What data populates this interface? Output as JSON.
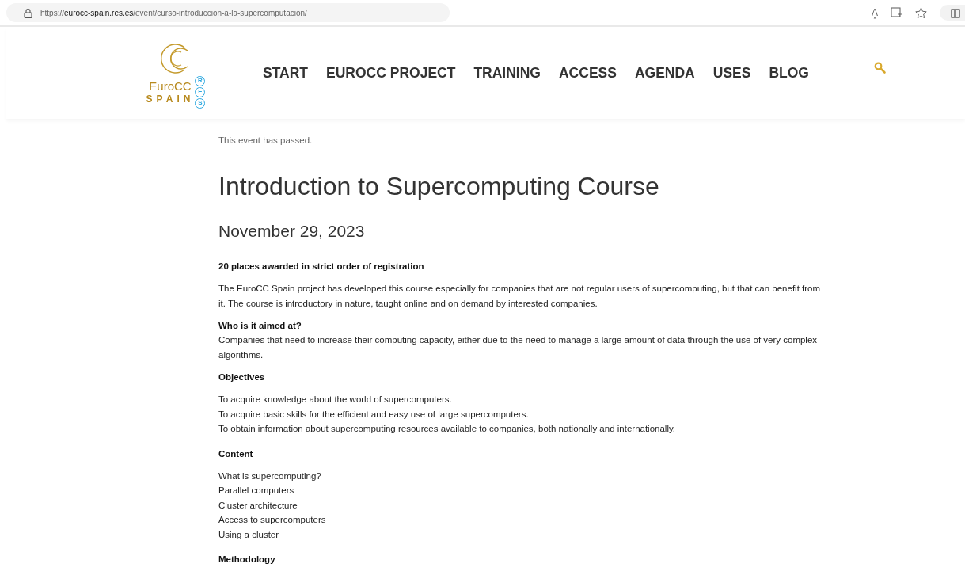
{
  "browser": {
    "url": {
      "scheme": "https://",
      "host": "eurocc-spain.res.es",
      "path": "/event/curso-introduccion-a-la-supercomputacion/"
    },
    "read_aloud": "A͓"
  },
  "logo": {
    "top": "EuroCC",
    "bottom": "SPAIN",
    "badge": [
      "R",
      "E",
      "S"
    ]
  },
  "nav": [
    "START",
    "EUROCC PROJECT",
    "TRAINING",
    "ACCESS",
    "AGENDA",
    "USES",
    "BLOG"
  ],
  "notice": "This event has passed.",
  "title": "Introduction to Supercomputing Course",
  "date": "November 29, 2023",
  "blocks": [
    {
      "kind": "heading",
      "text": "20 places awarded in strict order of registration"
    },
    {
      "kind": "paragraph",
      "text": "The EuroCC Spain project has developed this course especially for companies that are not regular users of supercomputing, but that can benefit from it. The course is introductory in nature, taught online and on demand by interested companies."
    },
    {
      "kind": "heading",
      "text": "Who is it aimed at?"
    },
    {
      "kind": "paragraph",
      "text": "Companies that need to increase their computing capacity, either due to the need to manage a large amount of data through the use of very complex algorithms."
    },
    {
      "kind": "heading",
      "text": "Objectives"
    },
    {
      "kind": "list",
      "items": [
        "To acquire knowledge about the world of supercomputers.",
        "To acquire basic skills for the efficient and easy use of large supercomputers.",
        "To obtain information about supercomputing resources available to companies, both nationally and internationally."
      ]
    },
    {
      "kind": "heading",
      "text": "Content"
    },
    {
      "kind": "list",
      "items": [
        "What is supercomputing?",
        "Parallel computers",
        "Cluster architecture",
        "Access to supercomputers",
        "Using a cluster"
      ]
    },
    {
      "kind": "heading",
      "text": "Methodology"
    }
  ]
}
